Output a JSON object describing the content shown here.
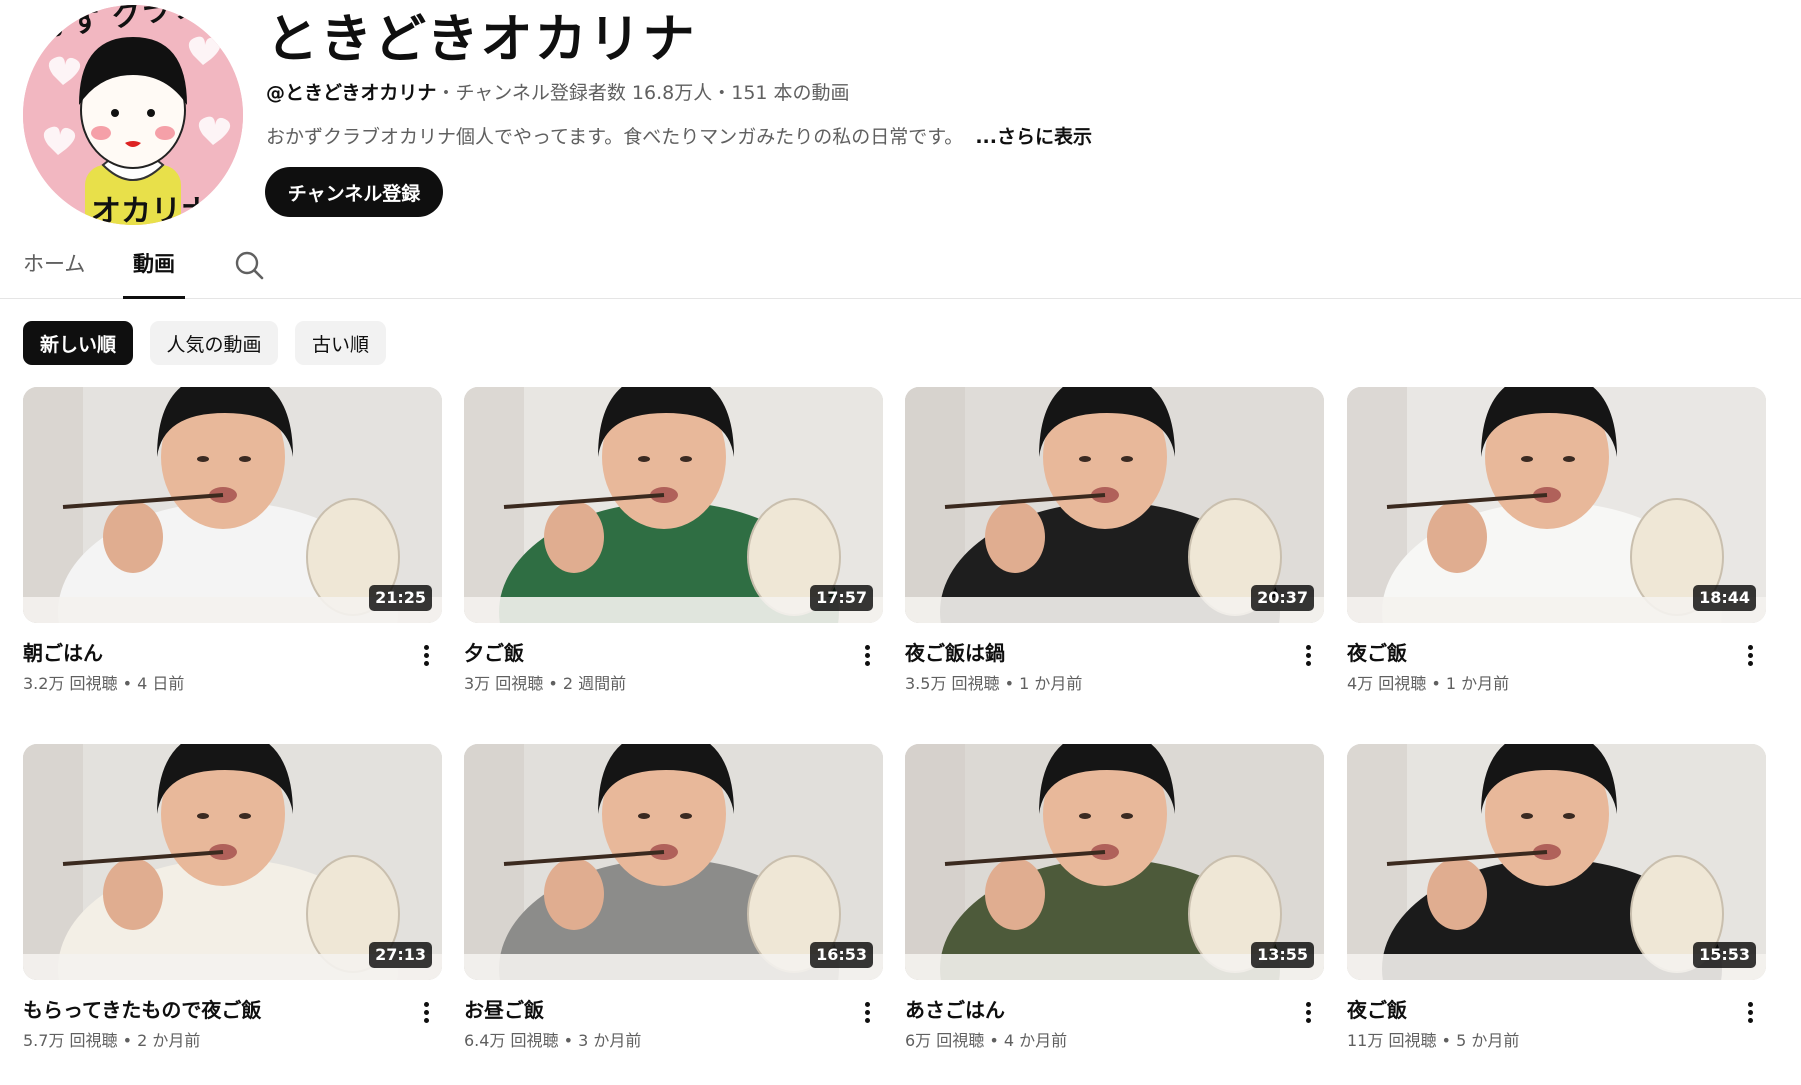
{
  "channel": {
    "name": "ときどきオカリナ",
    "handle": "@ときどきオカリナ",
    "subscribers": "チャンネル登録者数 16.8万人",
    "video_count": "151 本の動画",
    "separator": "・",
    "description": "おかずクラブオカリナ個人でやってます。食べたりマンガみたりの私の日常です。",
    "show_more": "...さらに表示",
    "subscribe_label": "チャンネル登録",
    "avatar_text": "おかずクラブ オカリナ"
  },
  "tabs": [
    {
      "label": "ホーム",
      "active": false
    },
    {
      "label": "動画",
      "active": true
    }
  ],
  "chips": [
    {
      "label": "新しい順",
      "selected": true
    },
    {
      "label": "人気の動画",
      "selected": false
    },
    {
      "label": "古い順",
      "selected": false
    }
  ],
  "videos": [
    {
      "title": "朝ごはん",
      "views": "3.2万 回視聴",
      "age": "4 日前",
      "duration": "21:25",
      "shirt": "#f4f4f4",
      "bg": "#e4e2df"
    },
    {
      "title": "夕ご飯",
      "views": "3万 回視聴",
      "age": "2 週間前",
      "duration": "17:57",
      "shirt": "#2f6e43",
      "bg": "#e8e6e2"
    },
    {
      "title": "夜ご飯は鍋",
      "views": "3.5万 回視聴",
      "age": "1 か月前",
      "duration": "20:37",
      "shirt": "#1e1e1e",
      "bg": "#dfdcd8"
    },
    {
      "title": "夜ご飯",
      "views": "4万 回視聴",
      "age": "1 か月前",
      "duration": "18:44",
      "shirt": "#f7f7f5",
      "bg": "#e9e7e4"
    },
    {
      "title": "もらってきたもので夜ご飯",
      "views": "5.7万 回視聴",
      "age": "2 か月前",
      "duration": "27:13",
      "shirt": "#f3efe6",
      "bg": "#e3e1dd"
    },
    {
      "title": "お昼ご飯",
      "views": "6.4万 回視聴",
      "age": "3 か月前",
      "duration": "16:53",
      "shirt": "#8c8c8a",
      "bg": "#e1dfdb"
    },
    {
      "title": "あさごはん",
      "views": "6万 回視聴",
      "age": "4 か月前",
      "duration": "13:55",
      "shirt": "#4d5a3a",
      "bg": "#dcd9d4"
    },
    {
      "title": "夜ご飯",
      "views": "11万 回視聴",
      "age": "5 か月前",
      "duration": "15:53",
      "shirt": "#1b1b1b",
      "bg": "#e6e4e0"
    }
  ],
  "colors": {
    "accent": "#0f0f0f",
    "secondary_text": "#606060",
    "chip_bg": "#f2f2f2"
  }
}
